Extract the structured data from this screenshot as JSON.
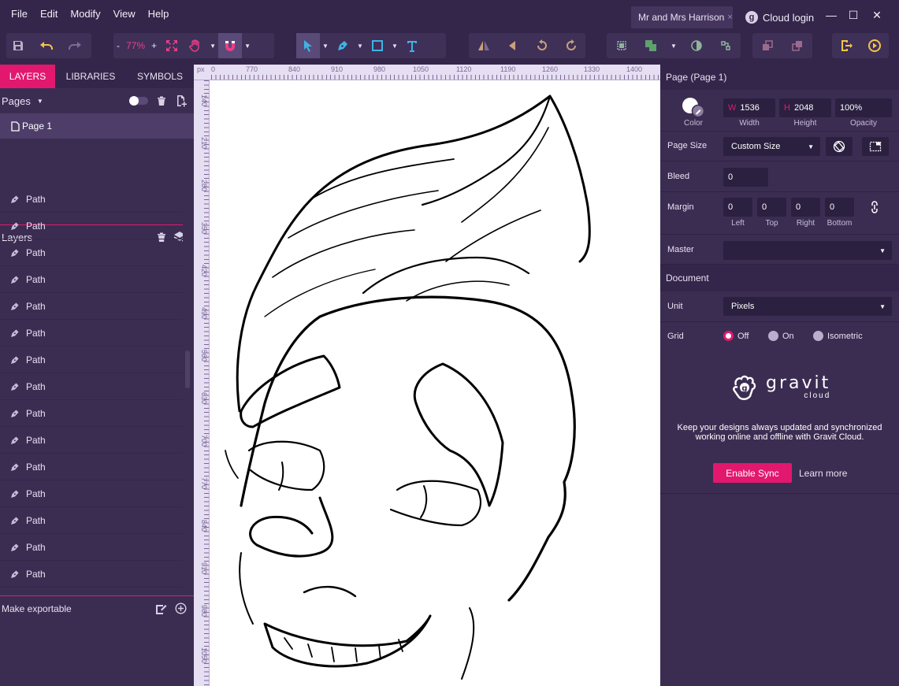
{
  "menu": [
    "File",
    "Edit",
    "Modify",
    "View",
    "Help"
  ],
  "document_tab": {
    "title": "Mr and Mrs Harrison",
    "close": "×"
  },
  "cloud_login": {
    "icon_letter": "g",
    "label": "Cloud login"
  },
  "window_controls": {
    "minimize": "—",
    "maximize": "☐",
    "close": "✕"
  },
  "toolbar": {
    "zoom_minus": "-",
    "zoom_value": "77%",
    "zoom_plus": "+"
  },
  "left_tabs": [
    "LAYERS",
    "LIBRARIES",
    "SYMBOLS"
  ],
  "pages": {
    "header": "Pages",
    "items": [
      "Page 1"
    ]
  },
  "layers": {
    "header": "Layers",
    "items": [
      "Path",
      "Path",
      "Path",
      "Path",
      "Path",
      "Path",
      "Path",
      "Path",
      "Path",
      "Path",
      "Path",
      "Path",
      "Path",
      "Path",
      "Path"
    ]
  },
  "make_exportable": "Make exportable",
  "ruler": {
    "unit": "px",
    "top": [
      "0",
      "770",
      "840",
      "910",
      "980",
      "1050",
      "1120",
      "1190",
      "1260",
      "1330",
      "1400"
    ],
    "left": [
      "140",
      "210",
      "280",
      "350",
      "420",
      "490",
      "560",
      "630",
      "700",
      "770",
      "840",
      "910",
      "980",
      "1050"
    ]
  },
  "right_panel": {
    "title": "Page (Page 1)",
    "color_label": "Color",
    "width": {
      "prefix": "W",
      "value": "1536",
      "label": "Width"
    },
    "height": {
      "prefix": "H",
      "value": "2048",
      "label": "Height"
    },
    "opacity": {
      "value": "100%",
      "label": "Opacity"
    },
    "page_size": {
      "label": "Page Size",
      "value": "Custom Size"
    },
    "bleed": {
      "label": "Bleed",
      "value": "0"
    },
    "margin": {
      "label": "Margin",
      "left": "0",
      "top": "0",
      "right": "0",
      "bottom": "0",
      "left_label": "Left",
      "top_label": "Top",
      "right_label": "Right",
      "bottom_label": "Bottom"
    },
    "master": {
      "label": "Master",
      "value": ""
    },
    "document_title": "Document",
    "unit": {
      "label": "Unit",
      "value": "Pixels"
    },
    "grid": {
      "label": "Grid",
      "options": [
        "Off",
        "On",
        "Isometric"
      ],
      "selected": "Off"
    },
    "promo": {
      "logo_word": "gravit",
      "logo_sub": "cloud",
      "text": "Keep your designs always updated and synchronized working online and offline with Gravit Cloud.",
      "enable_sync": "Enable Sync",
      "learn_more": "Learn more"
    }
  },
  "colors": {
    "accent": "#e2186f",
    "panel": "#3b2d52",
    "bar": "#34264a"
  }
}
